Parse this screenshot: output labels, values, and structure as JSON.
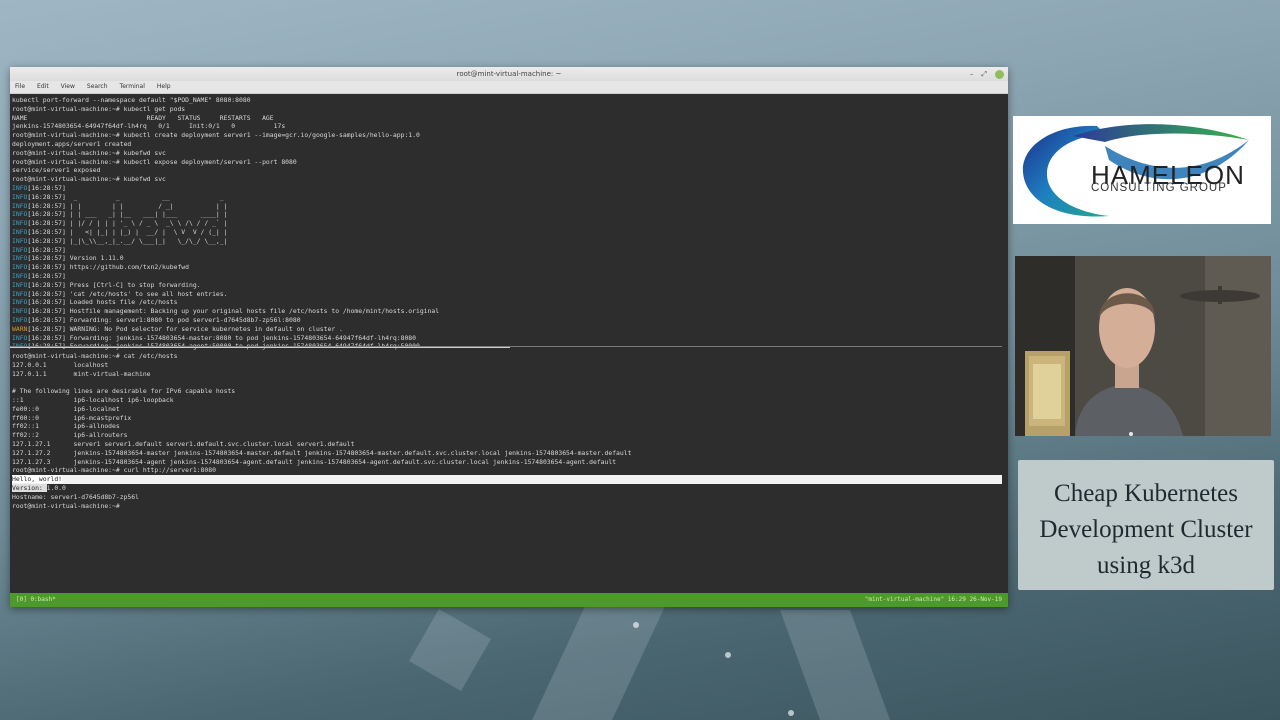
{
  "window": {
    "title": "root@mint-virtual-machine: ~",
    "controls": {
      "minimize": "–",
      "maximize": "⤢"
    },
    "menu": [
      "File",
      "Edit",
      "View",
      "Search",
      "Terminal",
      "Help"
    ]
  },
  "terminal": {
    "top_lines": [
      {
        "text": "kubectl port-forward --namespace default \"$POD_NAME\" 8080:8080"
      },
      {
        "text": "root@mint-virtual-machine:~# kubectl get pods"
      },
      {
        "text": "NAME                               READY   STATUS     RESTARTS   AGE"
      },
      {
        "text": "jenkins-1574803654-64947f64df-lh4rq   0/1     Init:0/1   0          17s"
      },
      {
        "text": "root@mint-virtual-machine:~# kubectl create deployment server1 --image=gcr.io/google-samples/hello-app:1.0"
      },
      {
        "text": "deployment.apps/server1 created"
      },
      {
        "text": "root@mint-virtual-machine:~# kubefwd svc"
      },
      {
        "text": "root@mint-virtual-machine:~# kubectl expose deployment/server1 --port 8080"
      },
      {
        "text": "service/server1 exposed"
      },
      {
        "text": "root@mint-virtual-machine:~# kubefwd svc"
      },
      {
        "tag": "INFO",
        "text": "[16:28:57]"
      },
      {
        "tag": "INFO",
        "text": "[16:28:57]  _          _           __             _"
      },
      {
        "tag": "INFO",
        "text": "[16:28:57] | |        | |         / _|           | |"
      },
      {
        "tag": "INFO",
        "text": "[16:28:57] | | ___   _| |__   ___| |___      ____| |"
      },
      {
        "tag": "INFO",
        "text": "[16:28:57] | |/ / | | | '_ \\ / _ \\  _\\ \\ /\\ / / _` |"
      },
      {
        "tag": "INFO",
        "text": "[16:28:57] |   <| |_| | |_) |  __/ |  \\ V  V / (_| |"
      },
      {
        "tag": "INFO",
        "text": "[16:28:57] |_|\\_\\\\__,_|_.__/ \\___|_|   \\_/\\_/ \\__,_|"
      },
      {
        "tag": "INFO",
        "text": "[16:28:57]"
      },
      {
        "tag": "INFO",
        "text": "[16:28:57] Version 1.11.0"
      },
      {
        "tag": "INFO",
        "text": "[16:28:57] https://github.com/txn2/kubefwd"
      },
      {
        "tag": "INFO",
        "text": "[16:28:57]"
      },
      {
        "tag": "INFO",
        "text": "[16:28:57] Press [Ctrl-C] to stop forwarding."
      },
      {
        "tag": "INFO",
        "text": "[16:28:57] 'cat /etc/hosts' to see all host entries."
      },
      {
        "tag": "INFO",
        "text": "[16:28:57] Loaded hosts file /etc/hosts"
      },
      {
        "tag": "INFO",
        "text": "[16:28:57] Hostfile management: Backing up your original hosts file /etc/hosts to /home/mint/hosts.original"
      },
      {
        "tag": "INFO",
        "text": "[16:28:57] Forwarding: server1:8080 to pod server1-d7645d8b7-zp56l:8080"
      },
      {
        "tag": "WARN",
        "text": "[16:28:57] WARNING: No Pod selector for service kubernetes in default on cluster ."
      },
      {
        "tag": "INFO",
        "text": "[16:28:57] Forwarding: jenkins-1574803654-master:8080 to pod jenkins-1574803654-64947f64df-lh4rq:8080"
      },
      {
        "tag": "INFO",
        "text": "[16:28:57] Forwarding: jenkins-1574803654-agent:50000 to pod jenkins-1574803654-64947f64df-lh4rq:50000"
      }
    ],
    "bottom_lines": [
      {
        "text": "root@mint-virtual-machine:~# cat /etc/hosts"
      },
      {
        "text": "127.0.0.1       localhost"
      },
      {
        "text": "127.0.1.1       mint-virtual-machine"
      },
      {
        "text": ""
      },
      {
        "text": "# The following lines are desirable for IPv6 capable hosts"
      },
      {
        "text": "::1             ip6-localhost ip6-loopback"
      },
      {
        "text": "fe00::0         ip6-localnet"
      },
      {
        "text": "ff00::0         ip6-mcastprefix"
      },
      {
        "text": "ff02::1         ip6-allnodes"
      },
      {
        "text": "ff02::2         ip6-allrouters"
      },
      {
        "text": "127.1.27.1      server1 server1.default server1.default.svc.cluster.local server1.default"
      },
      {
        "text": "127.1.27.2      jenkins-1574803654-master jenkins-1574803654-master.default jenkins-1574803654-master.default.svc.cluster.local jenkins-1574803654-master.default"
      },
      {
        "text": "127.1.27.3      jenkins-1574803654-agent jenkins-1574803654-agent.default jenkins-1574803654-agent.default.svc.cluster.local jenkins-1574803654-agent.default"
      },
      {
        "text": "root@mint-virtual-machine:~# curl http://server1:8080"
      }
    ],
    "hello_line": "Hello, world!",
    "version_label": "Version: ",
    "version_value": "1.0.0",
    "hostname_line": "Hostname: server1-d7645d8b7-zp56l",
    "final_prompt": "root@mint-virtual-machine:~#",
    "status_left": "[0] 0:bash*",
    "status_right": "\"mint-virtual-machine\" 16:29 26-Nov-19"
  },
  "logo": {
    "title": "HAMELEON",
    "subtitle": "CONSULTING GROUP"
  },
  "caption": {
    "lines": [
      "Cheap Kubernetes",
      "Development Cluster",
      "using k3d"
    ]
  },
  "colors": {
    "info_tag": "#3aa0c8",
    "warn_tag": "#d89a2a",
    "status_bar": "#4c9a2a"
  }
}
